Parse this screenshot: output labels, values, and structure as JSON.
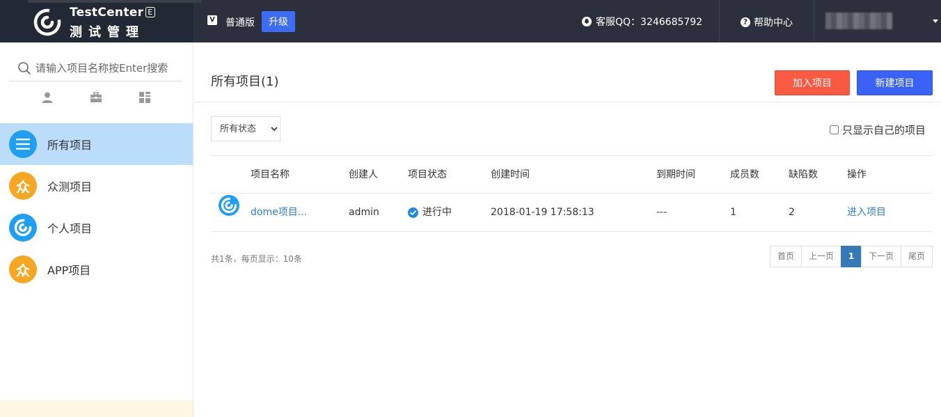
{
  "header": {
    "brand_title": "TestCenter",
    "brand_edition_mark": "E",
    "brand_subtitle": "测试管理",
    "version_badge": "V",
    "version_label": "普通版",
    "upgrade_label": "升级",
    "support_qq": "客服QQ：3246685792",
    "help_label": "帮助中心"
  },
  "sidebar": {
    "search_placeholder": "请输入项目名称按Enter搜索",
    "items": [
      {
        "label": "所有项目",
        "icon": "list-icon",
        "color": "#1e9ff2",
        "active": true
      },
      {
        "label": "众测项目",
        "icon": "crowd-icon",
        "glyph": "众",
        "color": "#f5a623"
      },
      {
        "label": "个人项目",
        "icon": "testcenter-logo-icon",
        "color": "#1e9ff2"
      },
      {
        "label": "APP项目",
        "icon": "crowd-icon",
        "glyph": "众",
        "color": "#f5a623"
      }
    ]
  },
  "main": {
    "title": "所有项目(1)",
    "join_label": "加入项目",
    "new_label": "新建项目",
    "status_filter": {
      "selected": "所有状态",
      "options": [
        "所有状态"
      ]
    },
    "own_only_label": "只显示自己的项目",
    "table": {
      "columns": [
        "项目名称",
        "创建人",
        "项目状态",
        "创建时间",
        "到期时间",
        "成员数",
        "缺陷数",
        "操作"
      ],
      "rows": [
        {
          "name": "dome项目...",
          "creator": "admin",
          "status": "进行中",
          "created": "2018-01-19 17:58:13",
          "expires": "---",
          "members": "1",
          "defects": "2",
          "action": "进入项目"
        }
      ]
    },
    "pager": {
      "info": "共1条，每页显示：10条",
      "first": "首页",
      "prev": "上一页",
      "current": "1",
      "next": "下一页",
      "last": "尾页"
    }
  },
  "colors": {
    "topbar": "#2b303c",
    "primary": "#3a62f6",
    "danger": "#fb5a42",
    "active_bg": "#bbddf9",
    "link": "#2b7de0"
  }
}
